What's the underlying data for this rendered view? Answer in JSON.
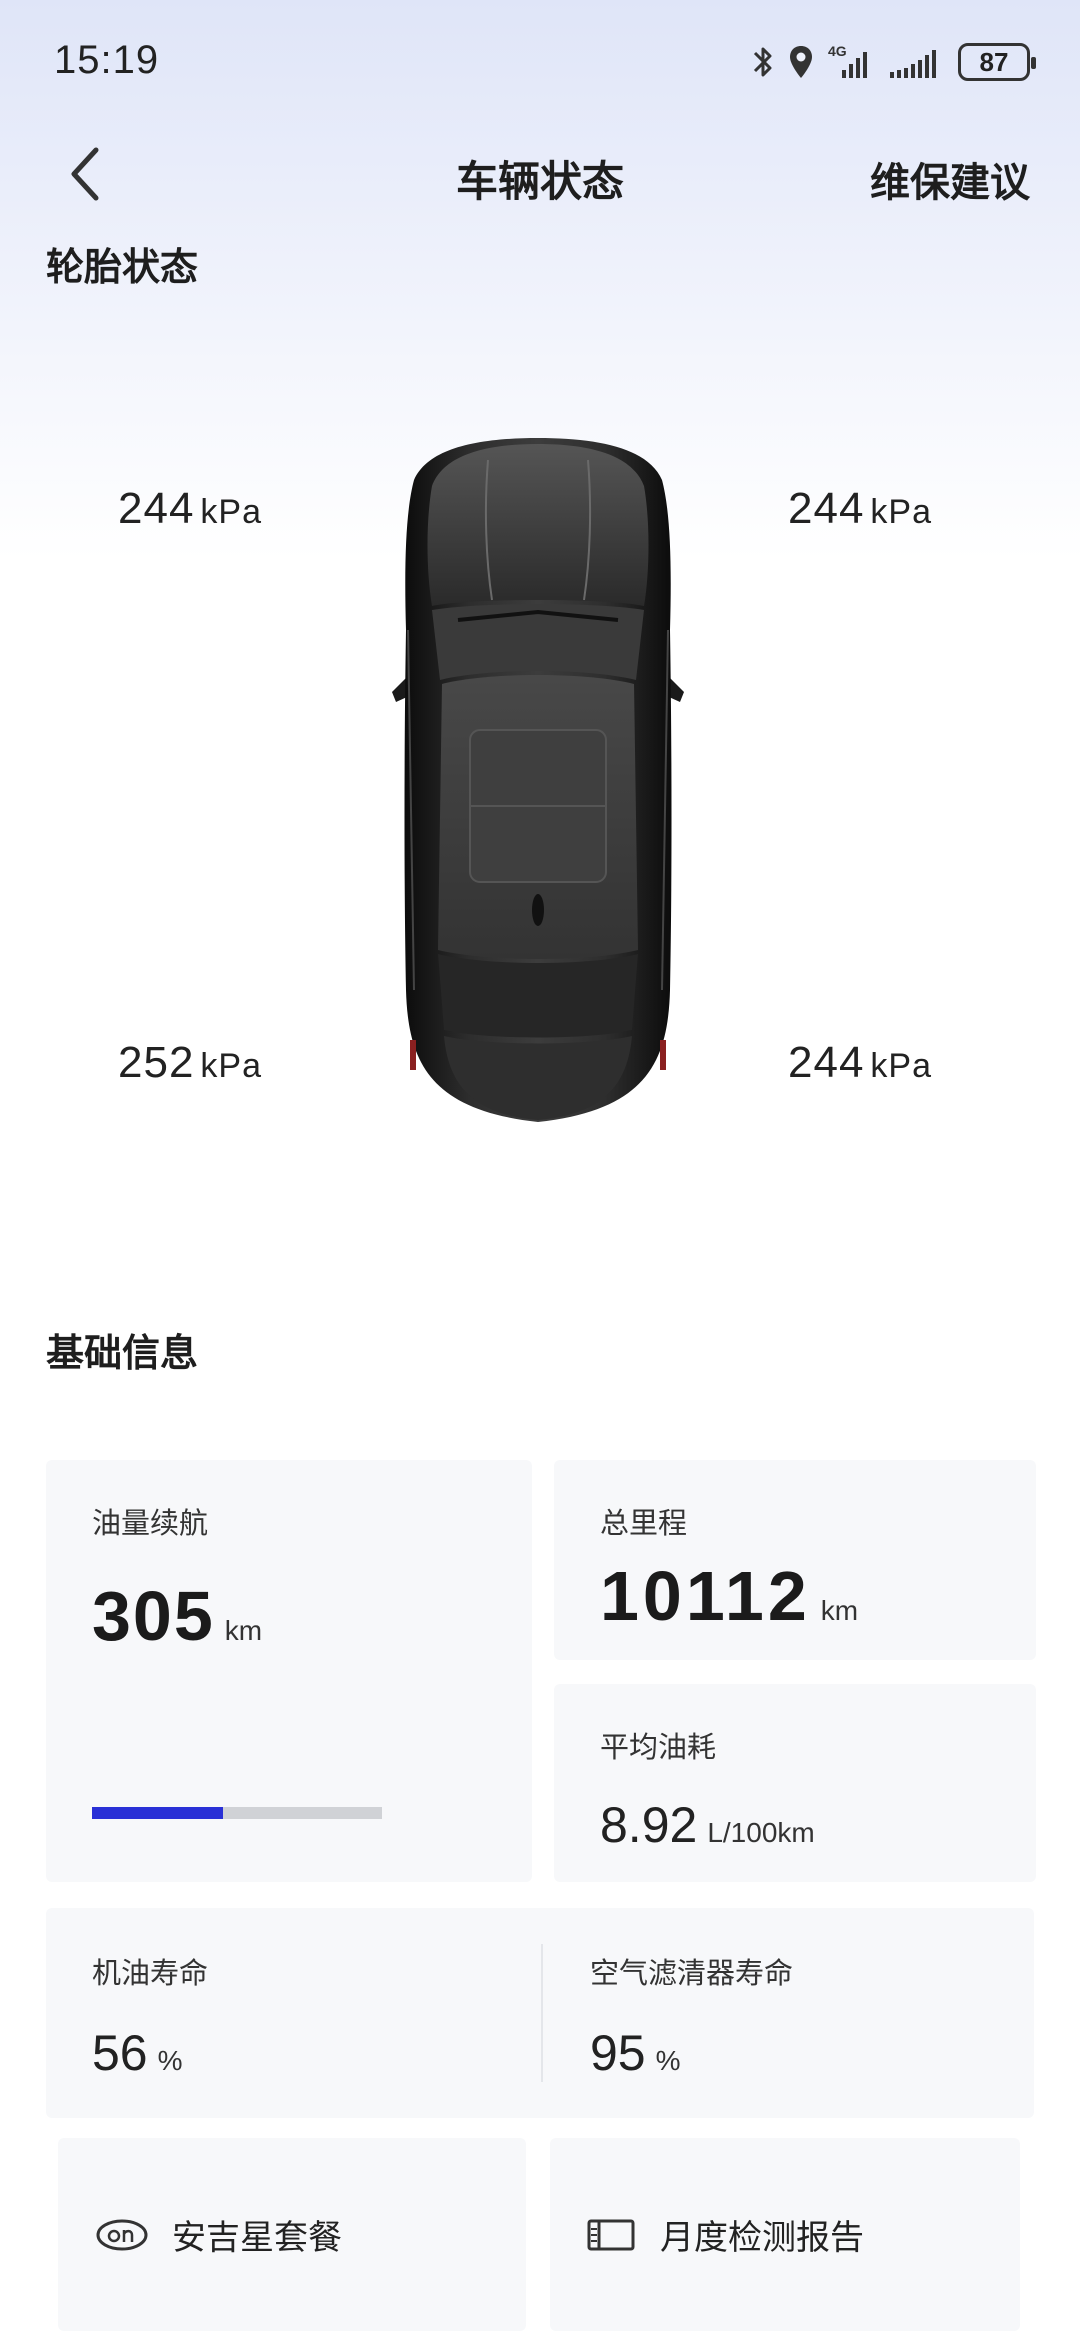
{
  "status_bar": {
    "time": "15:19",
    "network": "4G",
    "battery": "87",
    "icons": [
      "bluetooth-icon",
      "location-icon",
      "signal-4g-icon",
      "signal-icon",
      "battery-icon"
    ]
  },
  "header": {
    "title": "车辆状态",
    "right_link": "维保建议",
    "back_icon": "chevron-left-icon"
  },
  "tires": {
    "section_title": "轮胎状态",
    "unit": "kPa",
    "front_left": "244",
    "front_right": "244",
    "rear_left": "252",
    "rear_right": "244"
  },
  "basic_info": {
    "section_title": "基础信息",
    "fuel_range": {
      "label": "油量续航",
      "value": "305",
      "unit": "km",
      "fuel_level_fraction": 0.45
    },
    "total_mileage": {
      "label": "总里程",
      "value": "10112",
      "unit": "km"
    },
    "avg_consumption": {
      "label": "平均油耗",
      "value": "8.92",
      "unit": "L/100km"
    },
    "oil_life": {
      "label": "机油寿命",
      "value": "56",
      "unit": "%"
    },
    "air_filter_life": {
      "label": "空气滤清器寿命",
      "value": "95",
      "unit": "%"
    }
  },
  "actions": [
    {
      "label": "安吉星套餐",
      "icon": "onstar-icon"
    },
    {
      "label": "月度检测报告",
      "icon": "report-icon"
    }
  ],
  "colors": {
    "accent": "#2930d6",
    "card_bg": "#f7f8fa",
    "track": "#d0d2d6"
  }
}
